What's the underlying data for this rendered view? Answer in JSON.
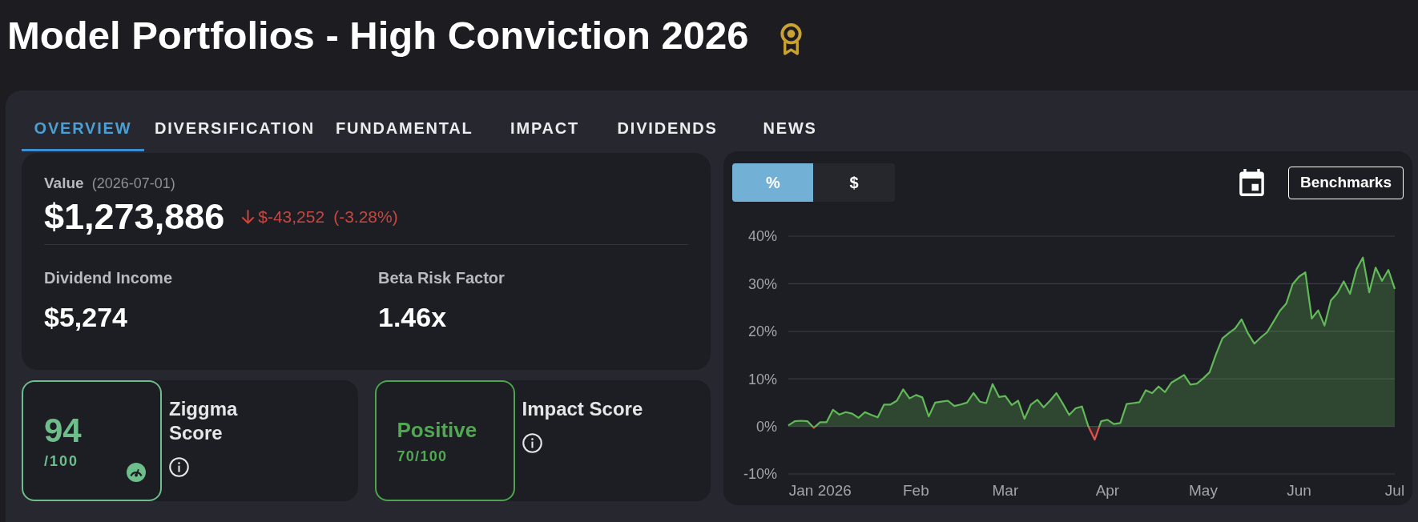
{
  "page": {
    "title": "Model Portfolios - High Conviction 2026"
  },
  "tabs": [
    {
      "label": "OVERVIEW",
      "selected": true
    },
    {
      "label": "DIVERSIFICATION",
      "selected": false
    },
    {
      "label": "FUNDAMENTAL",
      "selected": false
    },
    {
      "label": "IMPACT",
      "selected": false
    },
    {
      "label": "DIVIDENDS",
      "selected": false
    },
    {
      "label": "NEWS",
      "selected": false
    }
  ],
  "summary": {
    "value_label": "Value",
    "date": "(2026-07-01)",
    "value": "$1,273,886",
    "change": {
      "negative": true,
      "amount": "$-43,252",
      "percent": "(-3.28%)"
    },
    "metrics": [
      {
        "label": "Dividend Income",
        "value": "$5,274"
      },
      {
        "label": "Beta Risk Factor",
        "value": "1.46x"
      }
    ]
  },
  "score_cards": [
    {
      "kind": "numeric",
      "score": "94",
      "out_of": "/100",
      "label": "Ziggma Score"
    },
    {
      "kind": "rating",
      "rating": "Positive",
      "score": "70/100",
      "label": "Impact Score"
    }
  ],
  "chart": {
    "modes": [
      {
        "label": "%",
        "selected": true
      },
      {
        "label": "$",
        "selected": false
      }
    ],
    "benchmarks_button": "Benchmarks",
    "chart_data": {
      "type": "area",
      "grid": true,
      "categories": [
        null,
        null,
        null,
        null,
        null,
        "Jan 2026",
        null,
        null,
        null,
        null,
        null,
        null,
        null,
        null,
        null,
        null,
        null,
        null,
        null,
        null,
        "Feb",
        null,
        null,
        null,
        null,
        null,
        null,
        null,
        null,
        null,
        null,
        null,
        null,
        null,
        "Mar",
        null,
        null,
        null,
        null,
        null,
        null,
        null,
        null,
        null,
        null,
        null,
        null,
        null,
        null,
        null,
        "Apr",
        null,
        null,
        null,
        null,
        null,
        null,
        null,
        null,
        null,
        null,
        null,
        null,
        null,
        null,
        "May",
        null,
        null,
        null,
        null,
        null,
        null,
        null,
        null,
        null,
        null,
        null,
        null,
        null,
        null,
        "Jun",
        null,
        null,
        null,
        null,
        null,
        null,
        null,
        null,
        null,
        null,
        null,
        null,
        null,
        null,
        "Jul"
      ],
      "series": [
        {
          "color": "#62b957",
          "values": [
            0.2,
            1.1,
            1.2,
            1.1,
            -0.3,
            0.9,
            0.9,
            3.5,
            2.5,
            3.0,
            2.7,
            1.8,
            3.0,
            2.4,
            1.9,
            4.6,
            4.6,
            5.4,
            7.8,
            5.9,
            6.6,
            6.1,
            2.1,
            5.0,
            5.2,
            5.4,
            4.3,
            4.6,
            5.0,
            7.0,
            5.2,
            4.9,
            8.9,
            6.2,
            6.4,
            4.5,
            5.4,
            1.6,
            4.6,
            5.6,
            4.0,
            5.4,
            7.0,
            4.8,
            2.4,
            3.8,
            4.2,
            0.0,
            -2.8,
            1.1,
            1.4,
            0.5,
            0.7,
            4.7,
            4.9,
            5.1,
            7.6,
            7.0,
            8.4,
            7.2,
            9.2,
            10.0,
            10.8,
            8.8,
            9.0,
            10.1,
            11.4,
            15.2,
            18.5,
            19.6,
            20.6,
            22.5,
            19.6,
            17.4,
            18.7,
            19.8,
            22.0,
            24.3,
            25.8,
            29.9,
            31.5,
            32.4,
            22.7,
            24.4,
            21.2,
            26.5,
            28.0,
            30.5,
            27.9,
            33.0,
            35.5,
            28.2,
            33.4,
            30.6,
            32.9,
            28.9
          ]
        }
      ],
      "ylim": [
        -10,
        40
      ],
      "yticks": [
        {
          "value": -10,
          "label": "-10%"
        },
        {
          "value": 0,
          "label": "0%"
        },
        {
          "value": 10,
          "label": "10%"
        },
        {
          "value": 20,
          "label": "20%"
        },
        {
          "value": 30,
          "label": "30%"
        },
        {
          "value": 40,
          "label": "40%"
        }
      ]
    }
  }
}
